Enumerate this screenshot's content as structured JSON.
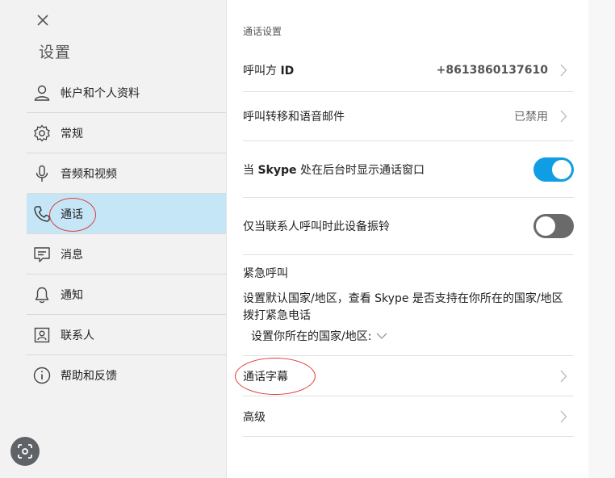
{
  "sidebar": {
    "title": "设置",
    "items": [
      {
        "label": "帐户和个人资料",
        "icon": "person-icon"
      },
      {
        "label": "常规",
        "icon": "gear-icon"
      },
      {
        "label": "音频和视频",
        "icon": "microphone-icon"
      },
      {
        "label": "通话",
        "icon": "phone-icon",
        "active": true
      },
      {
        "label": "消息",
        "icon": "message-icon"
      },
      {
        "label": "通知",
        "icon": "bell-icon"
      },
      {
        "label": "联系人",
        "icon": "contact-card-icon"
      },
      {
        "label": "帮助和反馈",
        "icon": "info-icon"
      }
    ]
  },
  "main": {
    "section_title": "通话设置",
    "caller_id": {
      "label": "呼叫方",
      "label_bold": "ID",
      "value": "+8613860137610"
    },
    "forwarding": {
      "label": "呼叫转移和语音邮件",
      "value": "已禁用"
    },
    "show_call_window": {
      "prefix": "当",
      "brand": "Skype",
      "suffix": "处在后台时显示通话窗口",
      "on": true
    },
    "ring_contacts_only": {
      "label": "仅当联系人呼叫时此设备振铃",
      "on": false
    },
    "emergency": {
      "title": "紧急呼叫",
      "description": "设置默认国家/地区，查看 Skype 是否支持在你所在的国家/地区拨打紧急电话",
      "link": "设置你所在的国家/地区:"
    },
    "captions": {
      "label": "通话字幕"
    },
    "advanced": {
      "label": "高级"
    }
  },
  "colors": {
    "accent": "#0f9ee3",
    "active_nav_bg": "#c5e6f7",
    "annotation": "#e23a3a",
    "sidebar_bg": "#f2f2f2"
  }
}
